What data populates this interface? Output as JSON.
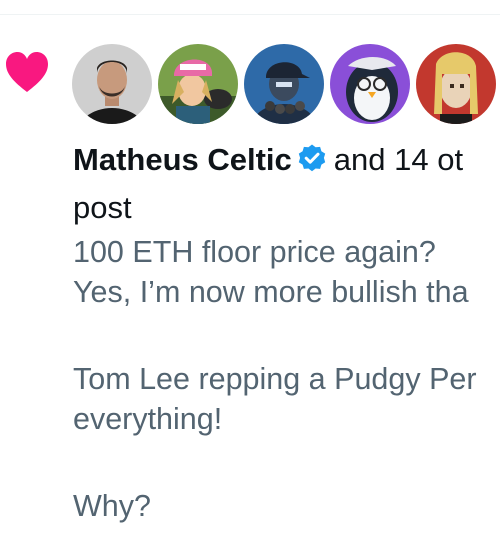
{
  "notification": {
    "actor_name": "Matheus Celtic",
    "rest_text": "and 14 ot",
    "subtitle": "post",
    "colors": {
      "heart": "#f91880",
      "verified": "#1d9bf0",
      "text_primary": "#0f1419",
      "text_secondary": "#536471"
    },
    "icons": [
      "heart-icon",
      "verified-badge-icon"
    ],
    "avatar_count": 5
  },
  "post": {
    "lines": [
      "100 ETH floor price again?",
      "Yes, I’m now more bullish tha",
      "",
      "Tom Lee repping a Pudgy Per",
      "everything!",
      "",
      "Why?"
    ]
  }
}
